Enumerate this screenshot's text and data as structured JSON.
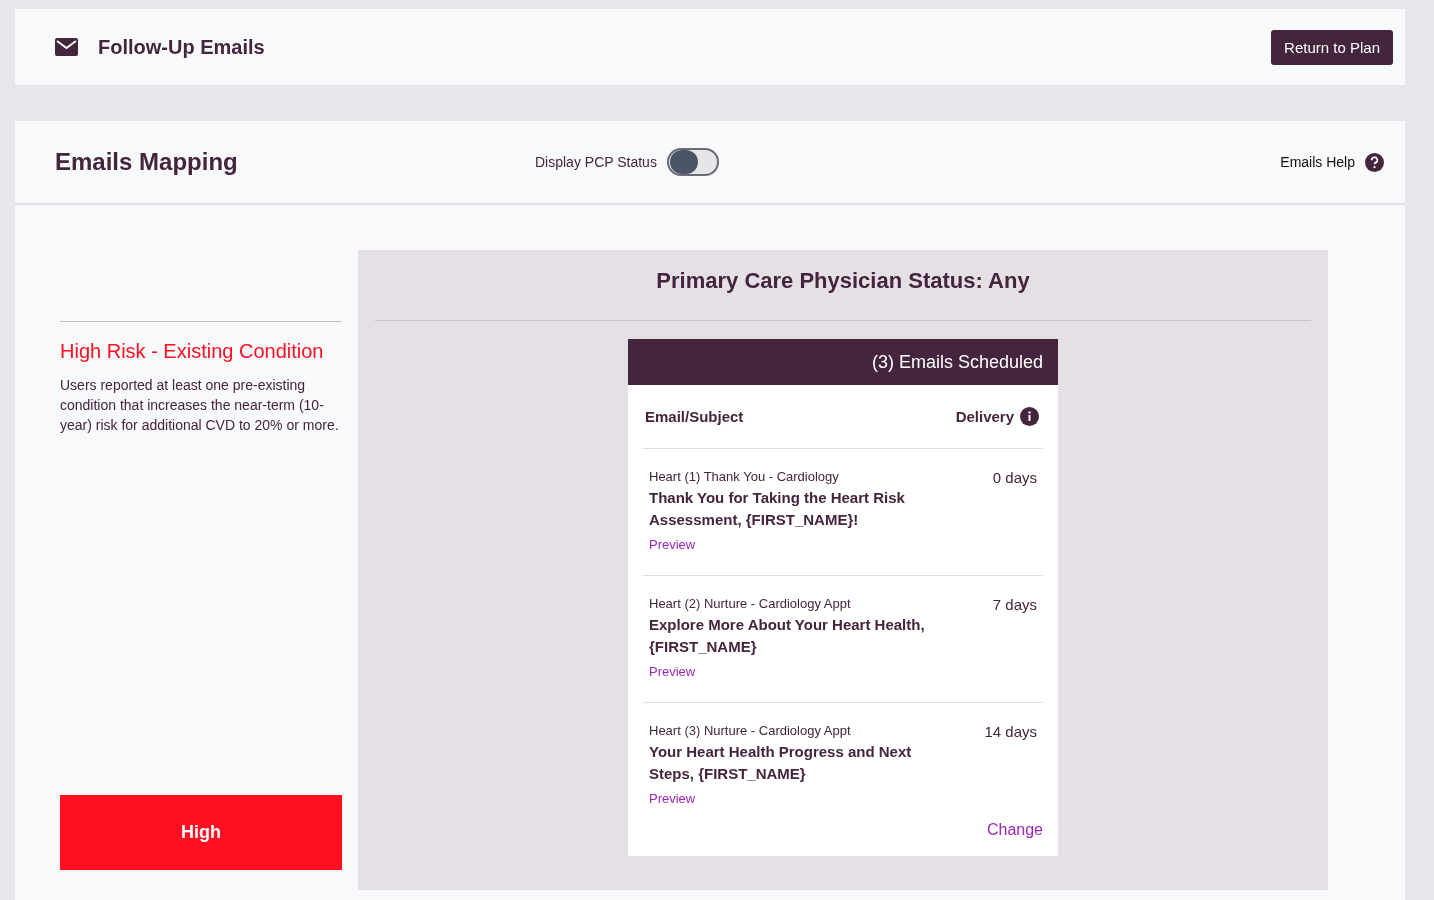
{
  "header": {
    "title": "Follow-Up Emails",
    "return_button": "Return to Plan"
  },
  "mapping": {
    "title": "Emails Mapping",
    "pcp_toggle": {
      "label": "Display PCP Status",
      "on": false
    },
    "help_link": "Emails Help"
  },
  "segment": {
    "title": "High Risk - Existing Condition",
    "description": "Users reported at least one pre-existing condition that increases the near-term (10-year) risk for additional CVD to 20% or more.",
    "level_badge": "High",
    "color": "#ff0f1f"
  },
  "panel": {
    "title": "Primary Care Physician Status: Any",
    "scheduled": "(3) Emails Scheduled",
    "columns": [
      "Email/Subject",
      "Delivery"
    ],
    "emails": [
      {
        "name": "Heart (1) Thank You - Cardiology",
        "subject": "Thank You for Taking the Heart Risk Assessment, {FIRST_NAME}!",
        "preview": "Preview",
        "delivery": "0 days"
      },
      {
        "name": "Heart (2) Nurture - Cardiology Appt",
        "subject": "Explore More About Your Heart Health, {FIRST_NAME}",
        "preview": "Preview",
        "delivery": "7 days"
      },
      {
        "name": "Heart (3) Nurture - Cardiology Appt",
        "subject": "Your Heart Health Progress and Next Steps, {FIRST_NAME}",
        "preview": "Preview",
        "delivery": "14 days"
      }
    ],
    "change_link": "Change"
  }
}
